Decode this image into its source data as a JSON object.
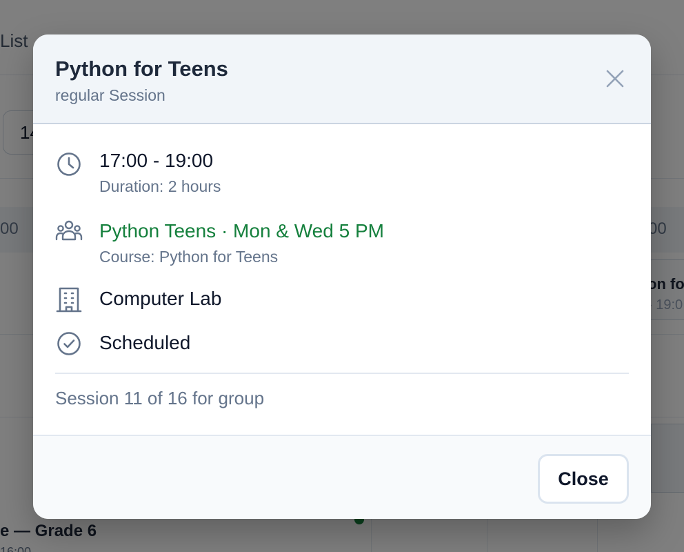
{
  "background": {
    "view_tab": "List",
    "date_value": "14",
    "time_left": "00",
    "time_right": "00",
    "card": {
      "title": "on fo",
      "time": "- 19:0"
    },
    "bottom_event": {
      "title": "e — Grade 6",
      "time": "16:00"
    }
  },
  "modal": {
    "title": "Python for Teens",
    "subtitle": "regular Session",
    "time": {
      "range": "17:00 - 19:00",
      "duration": "Duration: 2 hours",
      "icon": "clock-icon"
    },
    "group": {
      "name": "Python Teens · Mon & Wed 5 PM",
      "course": "Course: Python for Teens",
      "icon": "users-group-icon"
    },
    "room": {
      "name": "Computer Lab",
      "icon": "building-icon"
    },
    "status": {
      "label": "Scheduled",
      "icon": "check-circle-icon"
    },
    "session_count": "Session 11 of 16 for group",
    "close_label": "Close"
  },
  "colors": {
    "accent_green": "#15803d",
    "header_bg": "#f1f5f9",
    "muted_text": "#64748b",
    "icon_color": "#64748b"
  }
}
